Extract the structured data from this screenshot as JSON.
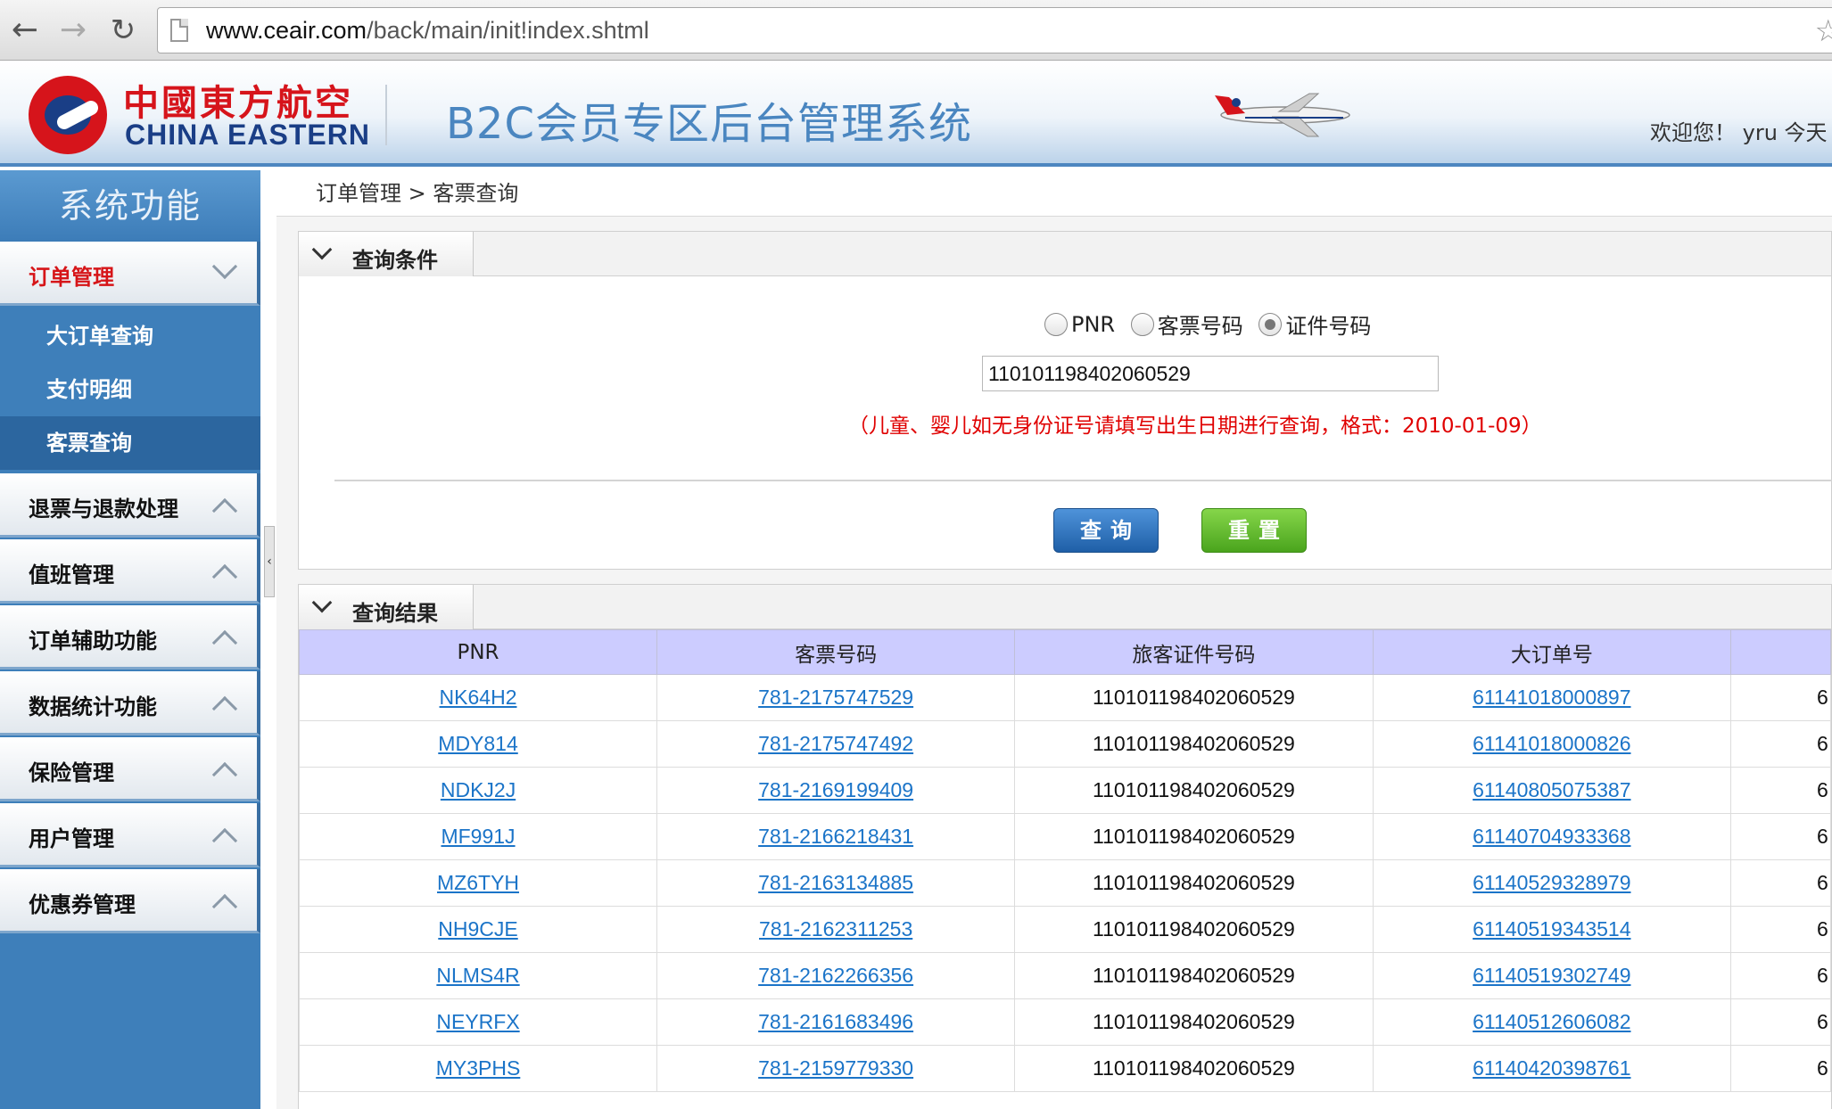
{
  "browser": {
    "url_host": "www.ceair.com",
    "url_path": "/back/main/init!index.shtml"
  },
  "header": {
    "logo_cn": "中國東方航空",
    "logo_en": "CHINA EASTERN",
    "system_title": "B2C会员专区后台管理系统",
    "welcome": "欢迎您！ yru 今天"
  },
  "sidebar": {
    "title": "系统功能",
    "menus": [
      {
        "label": "订单管理",
        "expanded": true
      },
      {
        "label": "退票与退款处理"
      },
      {
        "label": "值班管理"
      },
      {
        "label": "订单辅助功能"
      },
      {
        "label": "数据统计功能"
      },
      {
        "label": "保险管理"
      },
      {
        "label": "用户管理"
      },
      {
        "label": "优惠券管理"
      }
    ],
    "sub_items": [
      "大订单查询",
      "支付明细",
      "客票查询"
    ],
    "selected_sub_item": "客票查询"
  },
  "breadcrumb": "订单管理 > 客票查询",
  "query": {
    "panel_title": "查询条件",
    "radio_options": [
      "PNR",
      "客票号码",
      "证件号码"
    ],
    "selected_option": "证件号码",
    "input_value": "110101198402060529",
    "hint": "（儿童、婴儿如无身份证号请填写出生日期进行查询，格式：2010-01-09）",
    "search_label": "查询",
    "reset_label": "重置"
  },
  "results": {
    "panel_title": "查询结果",
    "columns": [
      "PNR",
      "客票号码",
      "旅客证件号码",
      "大订单号",
      ""
    ],
    "rows": [
      [
        "NK64H2",
        "781-2175747529",
        "110101198402060529",
        "61141018000897",
        "6"
      ],
      [
        "MDY814",
        "781-2175747492",
        "110101198402060529",
        "61141018000826",
        "6"
      ],
      [
        "NDKJ2J",
        "781-2169199409",
        "110101198402060529",
        "61140805075387",
        "6"
      ],
      [
        "MF991J",
        "781-2166218431",
        "110101198402060529",
        "61140704933368",
        "6"
      ],
      [
        "MZ6TYH",
        "781-2163134885",
        "110101198402060529",
        "61140529328979",
        "6"
      ],
      [
        "NH9CJE",
        "781-2162311253",
        "110101198402060529",
        "61140519343514",
        "6"
      ],
      [
        "NLMS4R",
        "781-2162266356",
        "110101198402060529",
        "61140519302749",
        "6"
      ],
      [
        "NEYRFX",
        "781-2161683496",
        "110101198402060529",
        "61140512606082",
        "6"
      ],
      [
        "MY3PHS",
        "781-2159779330",
        "110101198402060529",
        "61140420398761",
        "6"
      ]
    ]
  },
  "colors": {
    "brand_red": "#d6141b",
    "brand_blue": "#1a3e86",
    "sidebar_blue": "#3e7fba",
    "table_header": "#ccccff",
    "link": "#1b74c8",
    "hint_red": "#e00000"
  }
}
